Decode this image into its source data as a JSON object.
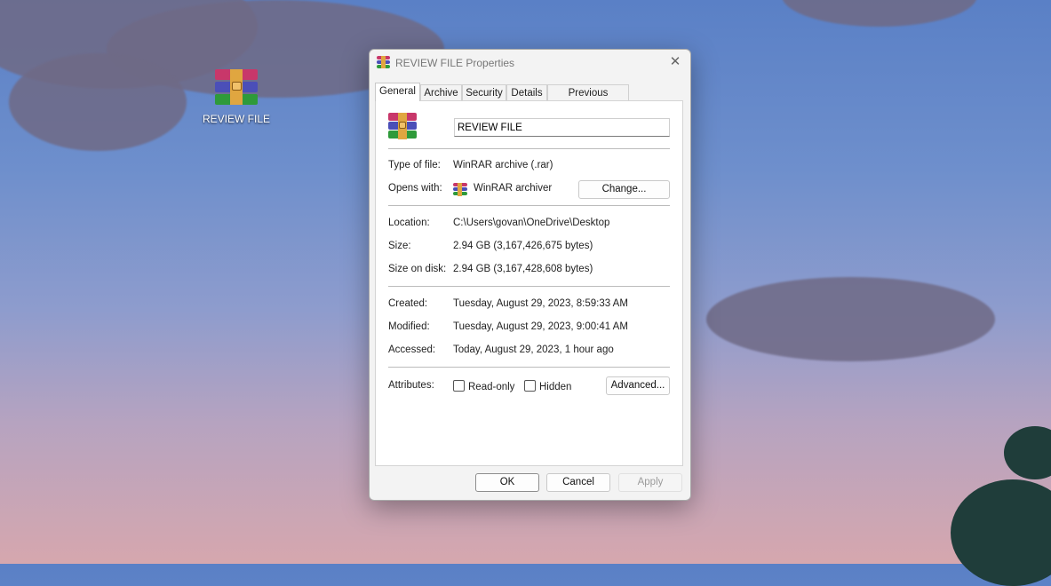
{
  "desktop": {
    "icon_label": "REVIEW FILE",
    "icon_name": "winrar-archive-icon"
  },
  "dialog": {
    "title": "REVIEW FILE Properties",
    "close_glyph": "✕",
    "tabs": [
      {
        "label": "General",
        "active": true
      },
      {
        "label": "Archive",
        "active": false
      },
      {
        "label": "Security",
        "active": false
      },
      {
        "label": "Details",
        "active": false
      },
      {
        "label": "Previous Versions",
        "active": false
      }
    ],
    "general": {
      "file_name": "REVIEW FILE",
      "type_label": "Type of file:",
      "type_value": "WinRAR archive (.rar)",
      "opens_label": "Opens with:",
      "opens_value": "WinRAR archiver",
      "change_button": "Change...",
      "location_label": "Location:",
      "location_value": "C:\\Users\\govan\\OneDrive\\Desktop",
      "size_label": "Size:",
      "size_value": "2.94 GB (3,167,426,675 bytes)",
      "size_disk_label": "Size on disk:",
      "size_disk_value": "2.94 GB (3,167,428,608 bytes)",
      "created_label": "Created:",
      "created_value": "Tuesday, August 29, 2023, 8:59:33 AM",
      "modified_label": "Modified:",
      "modified_value": "Tuesday, August 29, 2023, 9:00:41 AM",
      "accessed_label": "Accessed:",
      "accessed_value": "Today, August 29, 2023, 1 hour ago",
      "attributes_label": "Attributes:",
      "readonly_label": "Read-only",
      "readonly_checked": false,
      "hidden_label": "Hidden",
      "hidden_checked": false,
      "advanced_button": "Advanced..."
    },
    "buttons": {
      "ok": "OK",
      "cancel": "Cancel",
      "apply": "Apply"
    }
  },
  "colors": {
    "rar_band_top": "#c8376a",
    "rar_band_mid": "#4b4fb8",
    "rar_band_bottom": "#2e9a3a",
    "rar_strap": "#e0a640"
  }
}
